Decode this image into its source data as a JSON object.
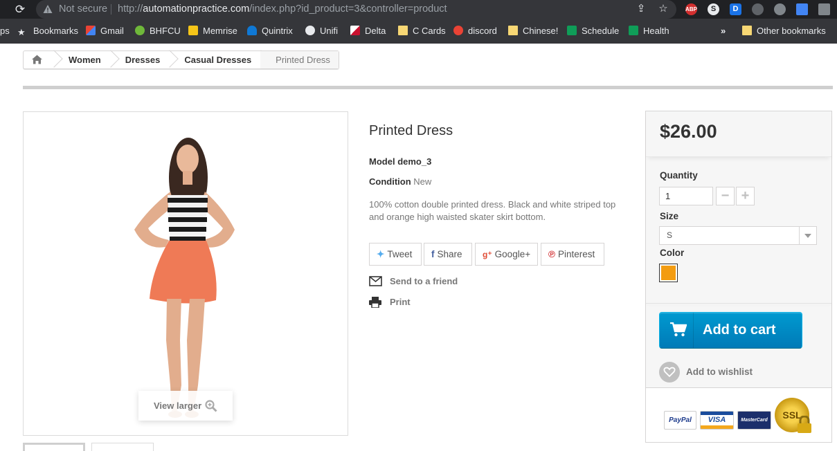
{
  "browser": {
    "not_secure": "Not secure",
    "url_prefix": "http://",
    "url_host": "automationpractice.com",
    "url_path": "/index.php?id_product=3&controller=product",
    "extensions": [
      {
        "name": "ABP",
        "color": "#d32f2f"
      },
      {
        "name": "S",
        "color": "#e0e0e0"
      },
      {
        "name": "D",
        "color": "#1a73e8"
      }
    ]
  },
  "bookmarks": {
    "apps_partial": "ps",
    "items": [
      {
        "label": "Bookmarks"
      },
      {
        "label": "Gmail"
      },
      {
        "label": "BHFCU"
      },
      {
        "label": "Memrise"
      },
      {
        "label": "Quintrix"
      },
      {
        "label": "Unifi"
      },
      {
        "label": "Delta"
      },
      {
        "label": "C Cards"
      },
      {
        "label": "discord"
      },
      {
        "label": "Chinese!"
      },
      {
        "label": "Schedule"
      },
      {
        "label": "Health"
      }
    ],
    "overflow": "»",
    "other": "Other bookmarks"
  },
  "breadcrumb": {
    "items": [
      "Women",
      "Dresses",
      "Casual Dresses"
    ],
    "current": "Printed Dress"
  },
  "product": {
    "title": "Printed Dress",
    "model_label": "Model",
    "model_value": "demo_3",
    "condition_label": "Condition",
    "condition_value": "New",
    "description": "100% cotton double printed dress. Black and white striped top and orange high waisted skater skirt bottom.",
    "view_larger": "View larger"
  },
  "social": {
    "tweet": "Tweet",
    "share": "Share",
    "google": "Google+",
    "pinterest": "Pinterest"
  },
  "actions": {
    "send_to_friend": "Send to a friend",
    "print": "Print"
  },
  "buy": {
    "price": "$26.00",
    "quantity_label": "Quantity",
    "quantity_value": "1",
    "minus": "−",
    "plus": "+",
    "size_label": "Size",
    "size_value": "S",
    "color_label": "Color",
    "color_swatch": "#f39c11",
    "add_to_cart": "Add to cart",
    "wishlist": "Add to wishlist",
    "payments": {
      "paypal": "PayPal",
      "visa": "VISA",
      "mastercard": "MasterCard",
      "ssl": "SSL"
    }
  }
}
